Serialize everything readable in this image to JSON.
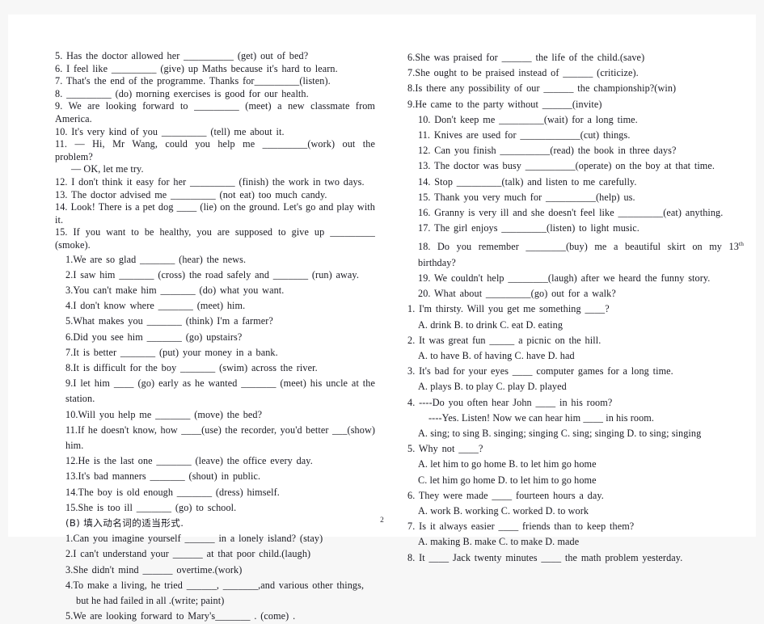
{
  "document": {
    "page_number": "2",
    "section_b_heading": "(B)  填入动名词的适当形式."
  },
  "left_column": {
    "verb_form_items": [
      "5. Has the doctor allowed her __________ (get) out of bed?",
      "6. I feel like _________ (give) up Maths because it's hard to learn.",
      "7. That's the end of the programme. Thanks for_________(listen).",
      "8. _________ (do) morning exercises is good for our health.",
      "9. We are looking forward to _________ (meet) a new classmate from America.",
      "10. It's very kind of you _________ (tell) me about it.",
      "11. — Hi, Mr Wang, could you help me _________(work) out the problem?",
      "— OK, let me try.",
      "12. I don't think it easy for her _________ (finish) the work in two days.",
      "13. The doctor advised me _________ (not eat) too much candy.",
      "14. Look! There is a pet dog ____ (lie) on the ground. Let's go and play with it.",
      "15. If you want to be healthy, you are supposed to give up _________ (smoke)."
    ],
    "second_set_items": [
      "1.We are so glad _______ (hear) the news.",
      "2.I saw him _______ (cross) the road safely and _______ (run) away.",
      "3.You can't make him _______ (do) what you want.",
      "4.I don't know where _______ (meet) him.",
      "5.What makes you _______ (think) I'm a farmer?",
      "6.Did you see him _______ (go) upstairs?",
      "7.It is better _______ (put) your money in a bank.",
      "8.It is difficult for the boy _______ (swim) across the river.",
      "9.I let him ____ (go) early as he wanted _______ (meet) his uncle at the station.",
      "10.Will you help me _______ (move) the bed?",
      "11.If he doesn't know, how ____(use) the recorder, you'd better ___(show) him.",
      "12.He is the last one _______ (leave) the office every day.",
      "13.It's bad manners _______ (shout) in public.",
      "14.The boy is old enough _______ (dress) himself.",
      "15.She is too ill _______ (go) to school."
    ],
    "gerund_items": [
      "1.Can you imagine yourself ______  in a lonely island? (stay)",
      "2.I can't understand your ______  at that poor child.(laugh)",
      "3.She didn't mind ______  overtime.(work)",
      "4.To make a living, he tried ______, _______,and various other things,",
      "but he had failed in all .(write; paint)",
      "5.We are looking forward to Mary's_______  . (come) ."
    ]
  },
  "right_column": {
    "gerund_items": [
      "6.She was praised for ______ the life of the child.(save)",
      "7.She ought to be praised instead of ______ (criticize).",
      "8.Is there any possibility of our ______  the championship?(win)",
      "9.He came to the party without ______(invite)",
      "10. Don't keep me _________(wait) for a long time.",
      "11. Knives are used for ____________(cut) things.",
      "12. Can you finish __________(read) the book in three days?",
      "13. The doctor was busy __________(operate) on the boy at that time.",
      "14. Stop _________(talk) and listen to me carefully.",
      "15. Thank you very much for __________(help) us.",
      "16. Granny is very ill and she doesn't feel like _________(eat) anything.",
      "17. The girl enjoys _________(listen) to light music.",
      "19. We couldn't help ________(laugh) after we heard the funny story.",
      "20. What about _________(go) out for a walk?"
    ],
    "item_18": {
      "before": "18. Do you remember ________(buy) me a beautiful skirt on my 13",
      "sup": "th",
      "after": " birthday?"
    },
    "multiple_choice": [
      {
        "stem": "1. I'm thirsty. Will you get me something ____?",
        "options": "A. drink      B. to drink     C. eat     D. eating"
      },
      {
        "stem": "2. It was great fun _____ a picnic on the hill.",
        "options": "A. to have      B. of having     C. have     D. had"
      },
      {
        "stem": "3. It's bad for your eyes ____ computer games for a long time.",
        "options": "A. plays      B. to play     C. play     D. played"
      },
      {
        "stem": "4. ----Do you often hear John ____ in his room?",
        "stem2": "----Yes. Listen! Now we can hear him ____ in his room.",
        "options": "A. sing; to sing B. singing; singing C. sing; singing      D. to sing; singing"
      },
      {
        "stem": "5. Why not ____?",
        "options": "A. let him to go home      B. to let him go home",
        "options2": "C. let him go home      D. to let him to go home"
      },
      {
        "stem": "6. They were made ____ fourteen hours a day.",
        "options": "A. work      B. working     C. worked     D. to work"
      },
      {
        "stem": "7. Is it always easier ____ friends than to keep them?",
        "options": "A. making      B. make     C. to make     D. made"
      },
      {
        "stem": "8. It ____ Jack twenty minutes ____ the math problem yesterday.",
        "options": ""
      }
    ]
  }
}
